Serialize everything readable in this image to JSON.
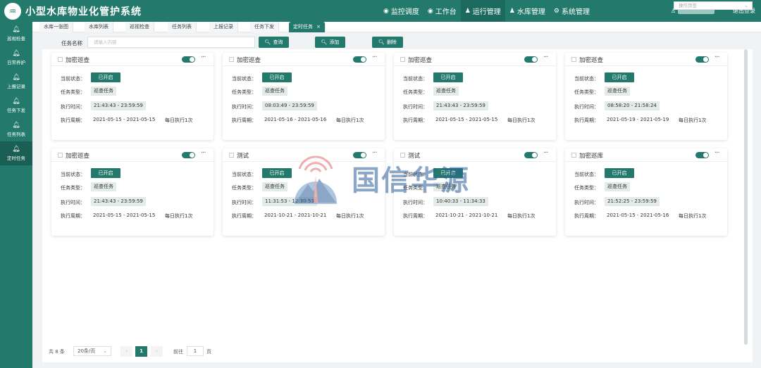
{
  "app": {
    "title": "小型水库物业化管护系统",
    "logo_glyph": "♒"
  },
  "topnav": [
    {
      "icon": "eye-icon",
      "glyph": "◉",
      "label": "监控调度"
    },
    {
      "icon": "desk-icon",
      "glyph": "◉",
      "label": "工作台"
    },
    {
      "icon": "person-icon",
      "glyph": "♟",
      "label": "运行管理",
      "active": true
    },
    {
      "icon": "person-icon",
      "glyph": "♟",
      "label": "水库管理"
    },
    {
      "icon": "settings-icon",
      "glyph": "⚙",
      "label": "系统管理"
    }
  ],
  "user": {
    "icon_glyph": "♙",
    "logout": "退出登录"
  },
  "sidebar": [
    {
      "glyph": "🔔︎",
      "label": "巡视检查"
    },
    {
      "glyph": "🔔︎",
      "label": "日常养护"
    },
    {
      "glyph": "🔔︎",
      "label": "上报记录"
    },
    {
      "glyph": "🔔︎",
      "label": "任务下发"
    },
    {
      "glyph": "🔔︎",
      "label": "任务列表"
    },
    {
      "glyph": "🔔︎",
      "label": "定时任务",
      "active": true
    }
  ],
  "tabs": [
    "水库一张图",
    "水库列表",
    "巡视检查",
    "任务列表",
    "上报记录",
    "任务下发",
    "定时任务"
  ],
  "tab_close": "×",
  "tab_select_placeholder": "操作页签",
  "search": {
    "label": "任务名称",
    "placeholder": "请输入内容",
    "query_btn": "查询",
    "add_btn": "添加",
    "delete_btn": "删除",
    "btn_glyph": "🔍︎"
  },
  "card_labels": {
    "status": "当前状态：",
    "type": "任务类型：",
    "time": "执行时间：",
    "period": "执行周期："
  },
  "cards": [
    {
      "title": "加密巡查",
      "status": "已开启",
      "type": "巡查任务",
      "time": "21:43:43 - 23:59:59",
      "period": "2021-05-15 - 2021-05-15",
      "freq": "每日执行1次"
    },
    {
      "title": "加密巡查",
      "status": "已开启",
      "type": "巡查任务",
      "time": "08:03:49 - 23:59:59",
      "period": "2021-05-16 - 2021-05-16",
      "freq": "每日执行1次"
    },
    {
      "title": "加密巡查",
      "status": "已开启",
      "type": "巡查任务",
      "time": "21:43:43 - 23:59:59",
      "period": "2021-05-15 - 2021-05-15",
      "freq": "每日执行1次"
    },
    {
      "title": "加密巡查",
      "status": "已开启",
      "type": "巡查任务",
      "time": "08:58:20 - 21:58:24",
      "period": "2021-05-19 - 2021-05-19",
      "freq": "每日执行1次"
    },
    {
      "title": "加密巡查",
      "status": "已开启",
      "type": "巡查任务",
      "time": "21:43:43 - 23:59:59",
      "period": "2021-05-15 - 2021-05-15",
      "freq": "每日执行1次"
    },
    {
      "title": "测试",
      "status": "已开启",
      "type": "巡查任务",
      "time": "11:31:53 - 12:30:53",
      "period": "2021-10-21 - 2021-10-21",
      "freq": "每日执行1次"
    },
    {
      "title": "测试",
      "status": "已开启",
      "type": "巡查任务",
      "time": "10:40:33 - 11:34:33",
      "period": "2021-10-21 - 2021-10-21",
      "freq": "每日执行1次"
    },
    {
      "title": "加密巡库",
      "status": "已开启",
      "type": "巡查任务",
      "time": "21:52:25 - 23:59:59",
      "period": "2021-05-15 - 2021-05-16",
      "freq": "每日执行1次"
    }
  ],
  "pagination": {
    "total": "共 8 条",
    "page_size": "20条/页",
    "prev": "‹",
    "next": "›",
    "current": "1",
    "goto_label": "前往",
    "goto_value": "1",
    "page_suffix": "页"
  },
  "watermark": {
    "text": "国信华源"
  },
  "colors": {
    "primary": "#237a6c",
    "tag_bg": "#e4ece9",
    "watermark_blue": "#2f5f9a"
  }
}
